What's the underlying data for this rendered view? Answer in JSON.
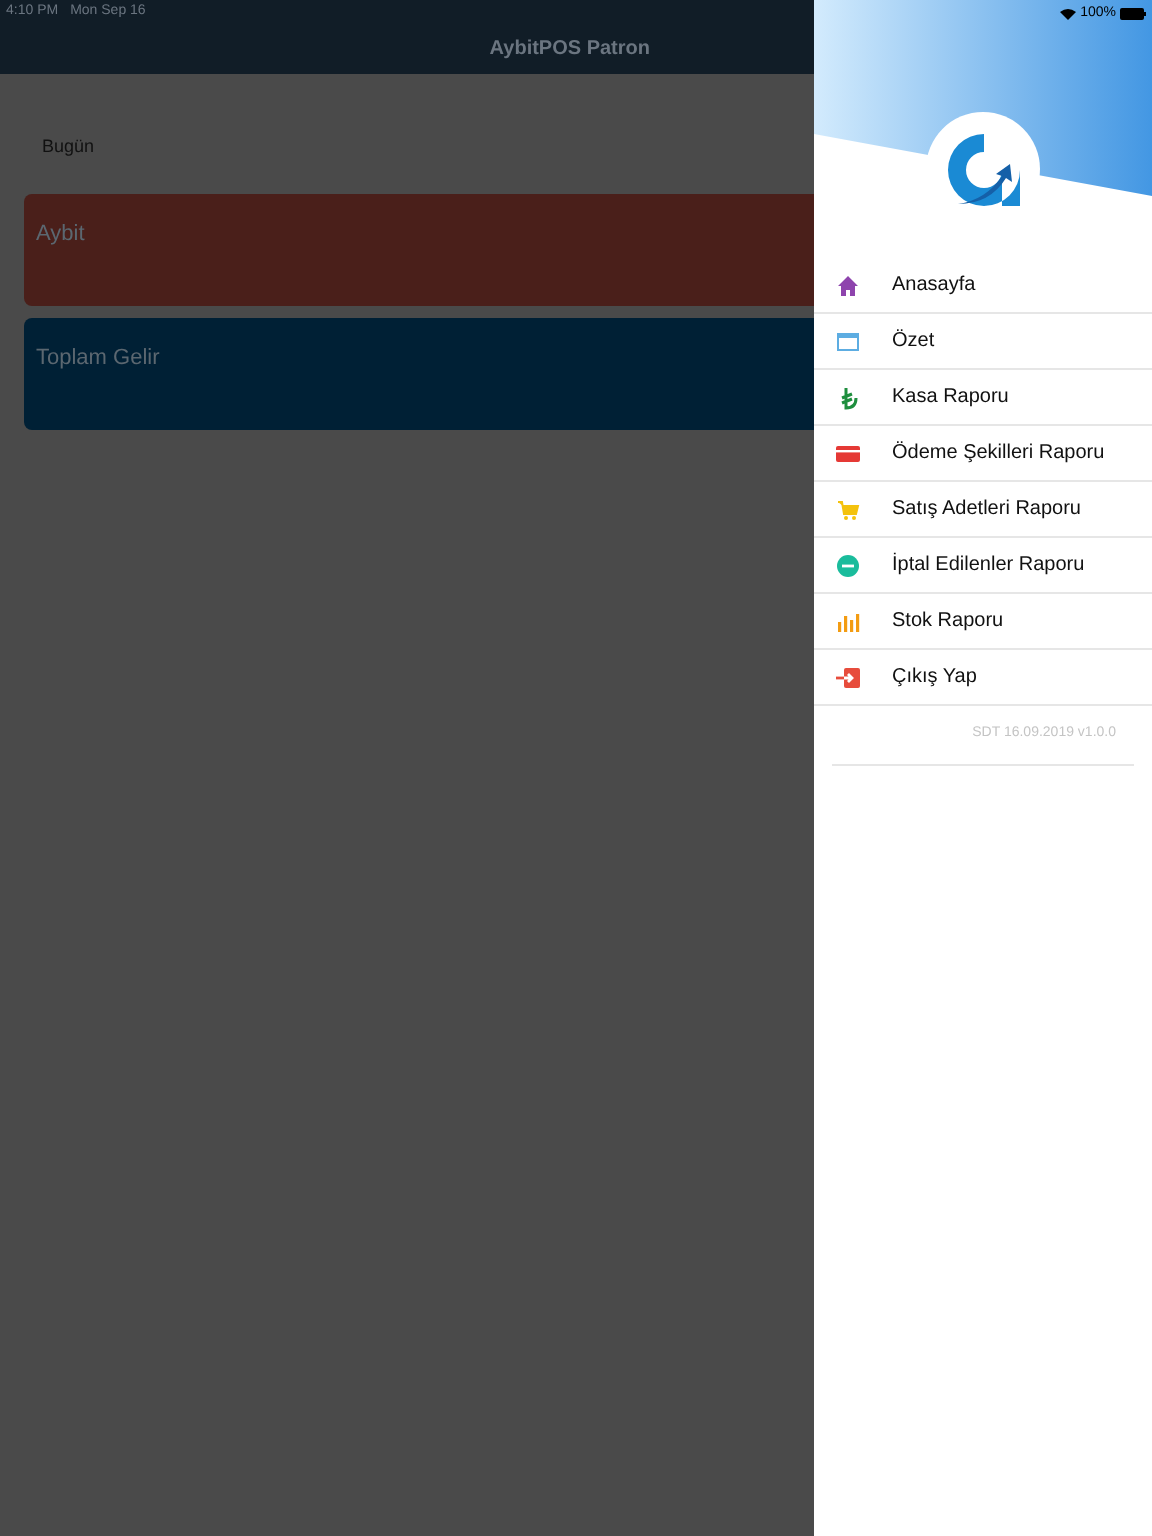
{
  "status_bar": {
    "time": "4:10 PM",
    "date": "Mon Sep 16",
    "battery": "100%"
  },
  "nav_bar": {
    "title": "AybitPOS Patron"
  },
  "period": "Bugün",
  "cards": [
    {
      "title": "Aybit",
      "color": "#4a1f1a"
    },
    {
      "title": "Toplam Gelir",
      "color": "#002035"
    }
  ],
  "menu": {
    "items": [
      {
        "kind": "home",
        "label": "Anasayfa"
      },
      {
        "kind": "calendar",
        "label": "Özet"
      },
      {
        "kind": "lira",
        "label": "Kasa Raporu"
      },
      {
        "kind": "card",
        "label": "Ödeme Şekilleri Raporu"
      },
      {
        "kind": "cart",
        "label": "Satış Adetleri Raporu"
      },
      {
        "kind": "cancel",
        "label": "İptal Edilenler Raporu"
      },
      {
        "kind": "chart",
        "label": "Stok Raporu"
      },
      {
        "kind": "logout",
        "label": "Çıkış Yap"
      }
    ],
    "version": "SDT 16.09.2019 v1.0.0"
  }
}
